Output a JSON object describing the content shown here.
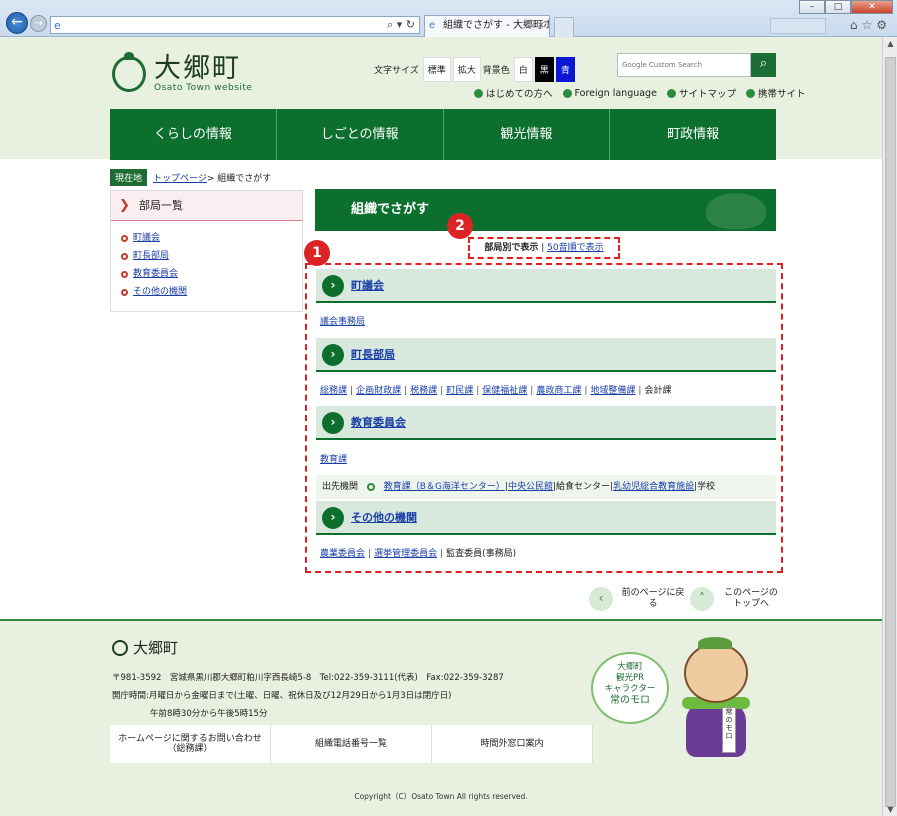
{
  "browser": {
    "address": "",
    "tab_title": "組織でさがす - 大郷町ホ...",
    "ghost_tab": ""
  },
  "site": {
    "title": "大郷町",
    "subtitle": "Osato Town website"
  },
  "tools": {
    "text_size_label": "文字サイズ",
    "standard": "標準",
    "enlarge": "拡大",
    "bgcolor_label": "背景色",
    "white": "白",
    "black": "黒",
    "blue": "青"
  },
  "search": {
    "placeholder": "Google Custom Search"
  },
  "quick_links": [
    "はじめての方へ",
    "Foreign language",
    "サイトマップ",
    "携帯サイト"
  ],
  "gnav": [
    "くらしの情報",
    "しごとの情報",
    "観光情報",
    "町政情報"
  ],
  "breadcrumb": {
    "here": "現在地",
    "top": "トップページ",
    "current": "> 組織でさがす"
  },
  "sidebar": {
    "heading": "部局一覧",
    "items": [
      "町議会",
      "町長部局",
      "教育委員会",
      "その他の機関"
    ]
  },
  "main": {
    "title": "組織でさがす",
    "toggle_current": "部局別で表示",
    "toggle_sep": "|",
    "toggle_other": "50音順で表示",
    "badge1": "1",
    "badge2": "2"
  },
  "sections": [
    {
      "title": "町議会",
      "links": [
        "議会事務局"
      ]
    },
    {
      "title": "町長部局",
      "links": [
        "総務課",
        "企画財政課",
        "税務課",
        "町民課",
        "保健福祉課",
        "農政商工課",
        "地域整備課"
      ],
      "plain": "会計課"
    },
    {
      "title": "教育委員会",
      "links": [
        "教育課"
      ]
    },
    {
      "title": "その他の機関",
      "links": [
        "農業委員会",
        "選挙管理委員会"
      ],
      "plain": "監査委員(事務局)"
    }
  ],
  "dept_row": {
    "label": "出先機関",
    "links": [
      "教育課（B＆G海洋センター）",
      "中央公民館"
    ],
    "plain1": "給食センター",
    "link3": "乳幼児総合教育施設",
    "plain2": "学校"
  },
  "page_nav": {
    "back": "前のページに戻る",
    "top": "このページのトップへ"
  },
  "footer": {
    "logo": "大郷町",
    "address": "〒981-3592　宮城県黒川郡大郷町粕川字西長崎5-8　Tel:022-359-3111(代表)　Fax:022-359-3287",
    "hours1": "開庁時間:月曜日から金曜日まで(土曜、日曜、祝休日及び12月29日から1月3日は閉庁日)",
    "hours2": "午前8時30分から午後5時15分",
    "buttons": [
      "ホームページに関するお問い合わせ（総務課）",
      "組織電話番号一覧",
      "時間外窓口案内"
    ],
    "copyright": "Copyright（C）Osato Town All rights reserved.",
    "bubble_line1": "大郷町",
    "bubble_line2": "観光PR",
    "bubble_line3": "キャラクター",
    "bubble_name": "常のモロ",
    "sash": "常のモロ"
  }
}
